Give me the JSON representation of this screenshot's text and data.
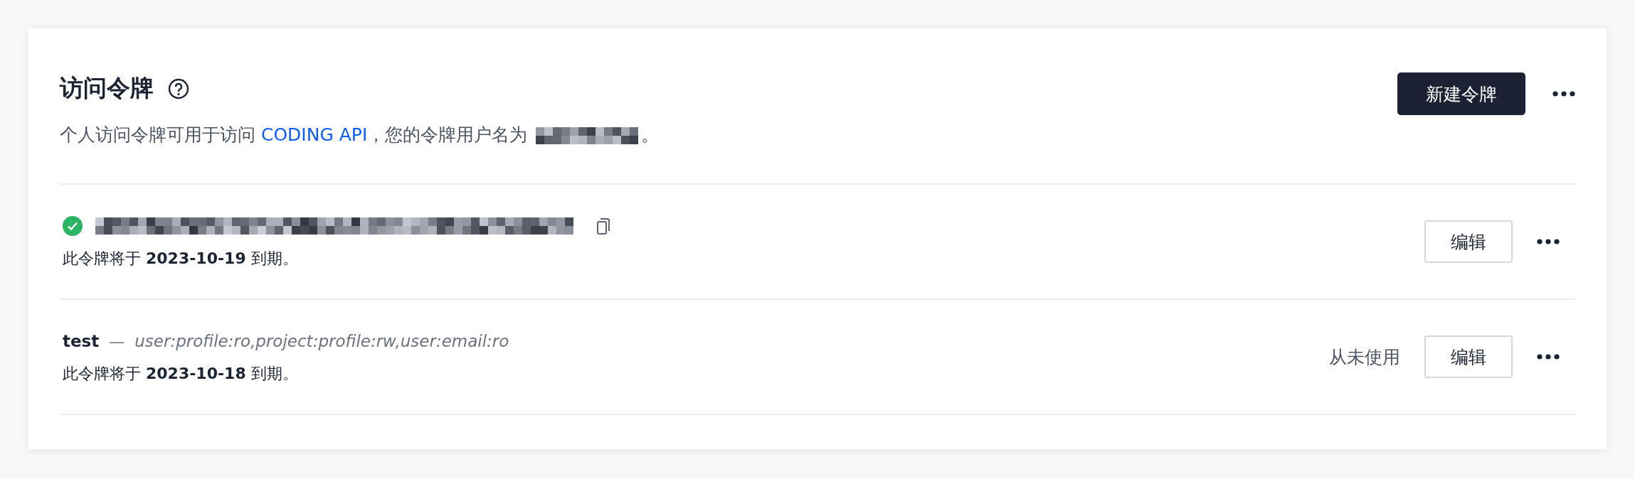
{
  "header": {
    "title": "访问令牌",
    "new_button": "新建令牌"
  },
  "description": {
    "text": "个人访问令牌可用于访问 ",
    "link": "CODING API",
    "after": "，您的令牌用户名为 ",
    "username_redacted": true,
    "end": "。"
  },
  "tokens": [
    {
      "kind": "verified",
      "redacted": true,
      "expiry": "此令牌将于 **2023-10-19** 到期。",
      "edit": "编辑"
    },
    {
      "kind": "named",
      "name": "test",
      "separator": "—",
      "scopes": "user:profile:ro,project:profile:rw,user:email:ro",
      "usage": "从未使用",
      "expiry": "此令牌将于 **2023-10-18** 到期。",
      "edit": "编辑"
    }
  ]
}
